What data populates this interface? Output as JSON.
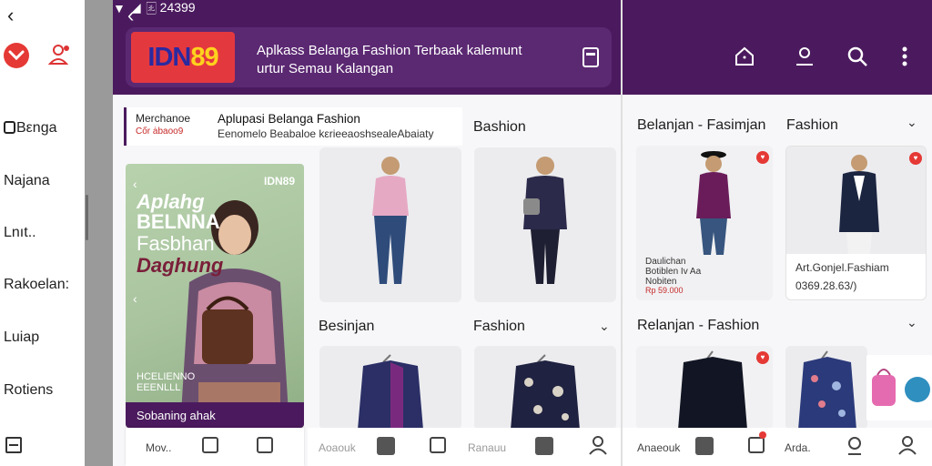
{
  "drawer": {
    "back": "‹",
    "nav": [
      "Bεnga",
      "Najana",
      "Lnıt..",
      "Rakoelan:",
      "Luiap",
      "Rotiens"
    ]
  },
  "status": {
    "text": "🀃 24399"
  },
  "banner": {
    "logo_part1": "IDN",
    "logo_part2": "89",
    "title": "Aplkass Belanga Fashion Terbaak kalemunt urtur Semau Kalangan"
  },
  "merch": {
    "label": "Merchanoe",
    "code": "Cốr ȧbaoo9",
    "title": "Aplupasi Belanga Fashion",
    "subtitle": "Eenomelo Beabaloe kεrieeaoshsealeAbaiaty"
  },
  "promo": {
    "brand": "IDN89",
    "lines": [
      "Aplahg",
      "BELNNA",
      "Fasbhan",
      "Daghung"
    ],
    "caption": "HCELIENNO\nEEENLLL",
    "strip": "Sobaning ahak"
  },
  "sections": {
    "fashion_top": "Bashion",
    "belanjan_left": "Besinjan",
    "fashion_mid": "Fashion",
    "belanja_right": "Belanjan - Fasimjan",
    "fashion_right": "Fashion",
    "relanjan_right": "Relanjan - Fashion"
  },
  "product_info": {
    "left_title": "Daulichan\nBotiblen Iv Aa\nNobiten",
    "left_price": "Rp 59.000",
    "right_title": "Art.Gonjel.Fashiam",
    "right_price": "0369.28.63/)"
  },
  "bottom": {
    "label_1": "Mov..",
    "label_2": "Aoaouk",
    "label_3": "Ranauu",
    "label_4": "Anaeouk",
    "label_5": "Arda."
  },
  "colors": {
    "brand_purple": "#4b1a5e",
    "accent_red": "#e53935",
    "logo_red": "#e4383f",
    "logo_yellow": "#ffd21e"
  }
}
